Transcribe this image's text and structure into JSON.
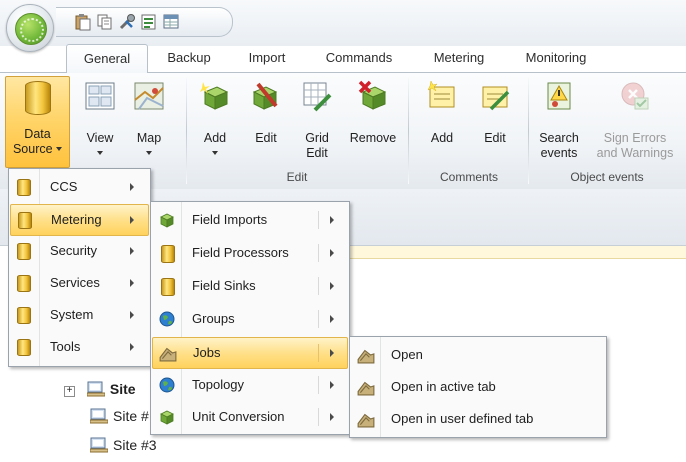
{
  "quick_access": {
    "icons": [
      "paste-icon",
      "copy-icon",
      "tools-icon",
      "report-icon",
      "grid-icon"
    ]
  },
  "tabs": [
    {
      "label": "General",
      "active": true
    },
    {
      "label": "Backup",
      "active": false
    },
    {
      "label": "Import",
      "active": false
    },
    {
      "label": "Commands",
      "active": false
    },
    {
      "label": "Metering",
      "active": false
    },
    {
      "label": "Monitoring",
      "active": false
    }
  ],
  "ribbon": {
    "data_source": {
      "line1": "Data",
      "line2": "Source",
      "pressed": true
    },
    "view": {
      "label": "View"
    },
    "map": {
      "label": "Map"
    },
    "edit_group": {
      "label": "Edit",
      "add": "Add",
      "edit": "Edit",
      "grid_edit_1": "Grid",
      "grid_edit_2": "Edit",
      "remove": "Remove"
    },
    "comments_group": {
      "label": "Comments",
      "add": "Add",
      "edit": "Edit"
    },
    "object_events_group": {
      "label": "Object events",
      "search_1": "Search",
      "search_2": "events",
      "sign_1": "Sign Errors",
      "sign_2": "and Warnings"
    }
  },
  "tree": {
    "expander": "+",
    "rows": [
      "Site",
      "Site #",
      "Site #3"
    ]
  },
  "menu_level1": [
    {
      "label": "CCS",
      "highlighted": false
    },
    {
      "label": "Metering",
      "highlighted": true
    },
    {
      "label": "Security",
      "highlighted": false
    },
    {
      "label": "Services",
      "highlighted": false
    },
    {
      "label": "System",
      "highlighted": false
    },
    {
      "label": "Tools",
      "highlighted": false
    }
  ],
  "menu_level2": [
    {
      "label": "Field Imports",
      "icon": "cube-icon",
      "highlighted": false
    },
    {
      "label": "Field Processors",
      "icon": "database-icon",
      "highlighted": false
    },
    {
      "label": "Field Sinks",
      "icon": "database-icon",
      "highlighted": false
    },
    {
      "label": "Groups",
      "icon": "globe-icon",
      "highlighted": false
    },
    {
      "label": "Jobs",
      "icon": "jobs-icon",
      "highlighted": true
    },
    {
      "label": "Topology",
      "icon": "globe-icon",
      "highlighted": false
    },
    {
      "label": "Unit Conversion",
      "icon": "cube-icon",
      "highlighted": false
    }
  ],
  "menu_level3": [
    {
      "label": "Open"
    },
    {
      "label": "Open in active tab"
    },
    {
      "label": "Open in user defined tab"
    }
  ],
  "colors": {
    "highlight": "#ffd25c",
    "menu_border": "#9aa3ab",
    "accent_green": "#72b93a"
  }
}
